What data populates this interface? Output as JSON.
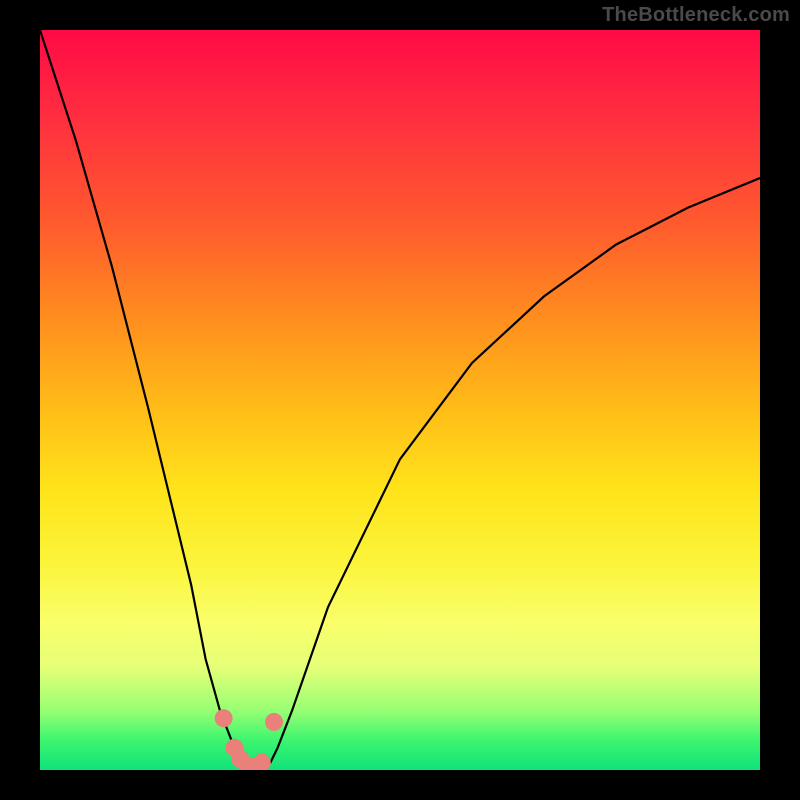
{
  "watermark": "TheBottleneck.com",
  "chart_data": {
    "type": "line",
    "title": "",
    "xlabel": "",
    "ylabel": "",
    "xlim": [
      0,
      100
    ],
    "ylim": [
      0,
      100
    ],
    "series": [
      {
        "name": "bottleneck-curve",
        "x": [
          0,
          5,
          10,
          15,
          18,
          21,
          23,
          25,
          27,
          28,
          29,
          30,
          31,
          32,
          33,
          35,
          40,
          50,
          60,
          70,
          80,
          90,
          100
        ],
        "values": [
          100,
          85,
          68,
          49,
          37,
          25,
          15,
          8,
          3,
          1,
          0,
          0,
          0,
          1,
          3,
          8,
          22,
          42,
          55,
          64,
          71,
          76,
          80
        ]
      }
    ],
    "markers": {
      "name": "highlight-points",
      "color": "#e98079",
      "x": [
        25.5,
        27.0,
        27.8,
        28.8,
        29.8,
        30.8,
        32.5
      ],
      "values": [
        7.0,
        3.0,
        1.5,
        0.5,
        0.5,
        1.0,
        6.5
      ]
    },
    "background_gradient": {
      "top": "#ff0a46",
      "mid": "#ffe31a",
      "bottom": "#10e37a"
    }
  }
}
